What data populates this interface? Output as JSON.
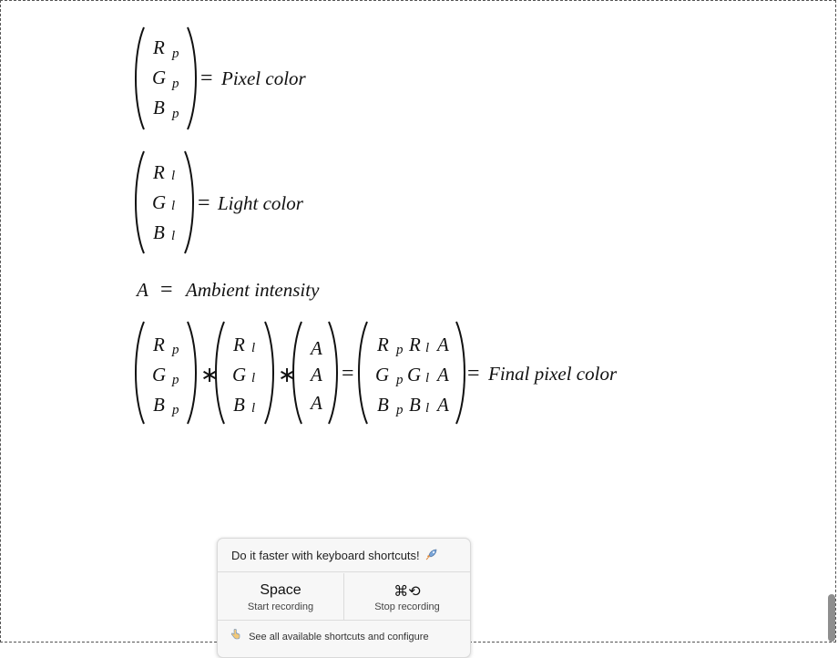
{
  "equations": {
    "pixel": {
      "rows": [
        "R",
        "G",
        "B"
      ],
      "subscript": "p",
      "equals": "=",
      "label": "Pixel  color"
    },
    "light": {
      "rows": [
        "R",
        "G",
        "B"
      ],
      "subscript": "l",
      "equals": "=",
      "label": "Light  color"
    },
    "ambient": {
      "var": "A",
      "equals": "=",
      "label": "Ambient  intensity"
    },
    "final": {
      "m1": [
        "R",
        "G",
        "B"
      ],
      "m1_sub": "p",
      "times": "∗",
      "m2": [
        "R",
        "G",
        "B"
      ],
      "m2_sub": "l",
      "m3": [
        "A",
        "A",
        "A"
      ],
      "equals": "=",
      "result": [
        {
          "a": "R",
          "b": "R",
          "c": "A"
        },
        {
          "a": "G",
          "b": "G",
          "c": "A"
        },
        {
          "a": "B",
          "b": "B",
          "c": "A"
        }
      ],
      "res_sub1": "p",
      "res_sub2": "l",
      "label": "Final   pixel  color"
    }
  },
  "popup": {
    "title": "Do it faster with keyboard shortcuts!",
    "title_icon": "rocket-icon",
    "start_key": "Space",
    "start_label": "Start recording",
    "stop_key": "⌘⟲",
    "stop_label": "Stop recording",
    "footer": "See all available shortcuts and configure",
    "footer_icon": "pointing-hand-icon"
  }
}
